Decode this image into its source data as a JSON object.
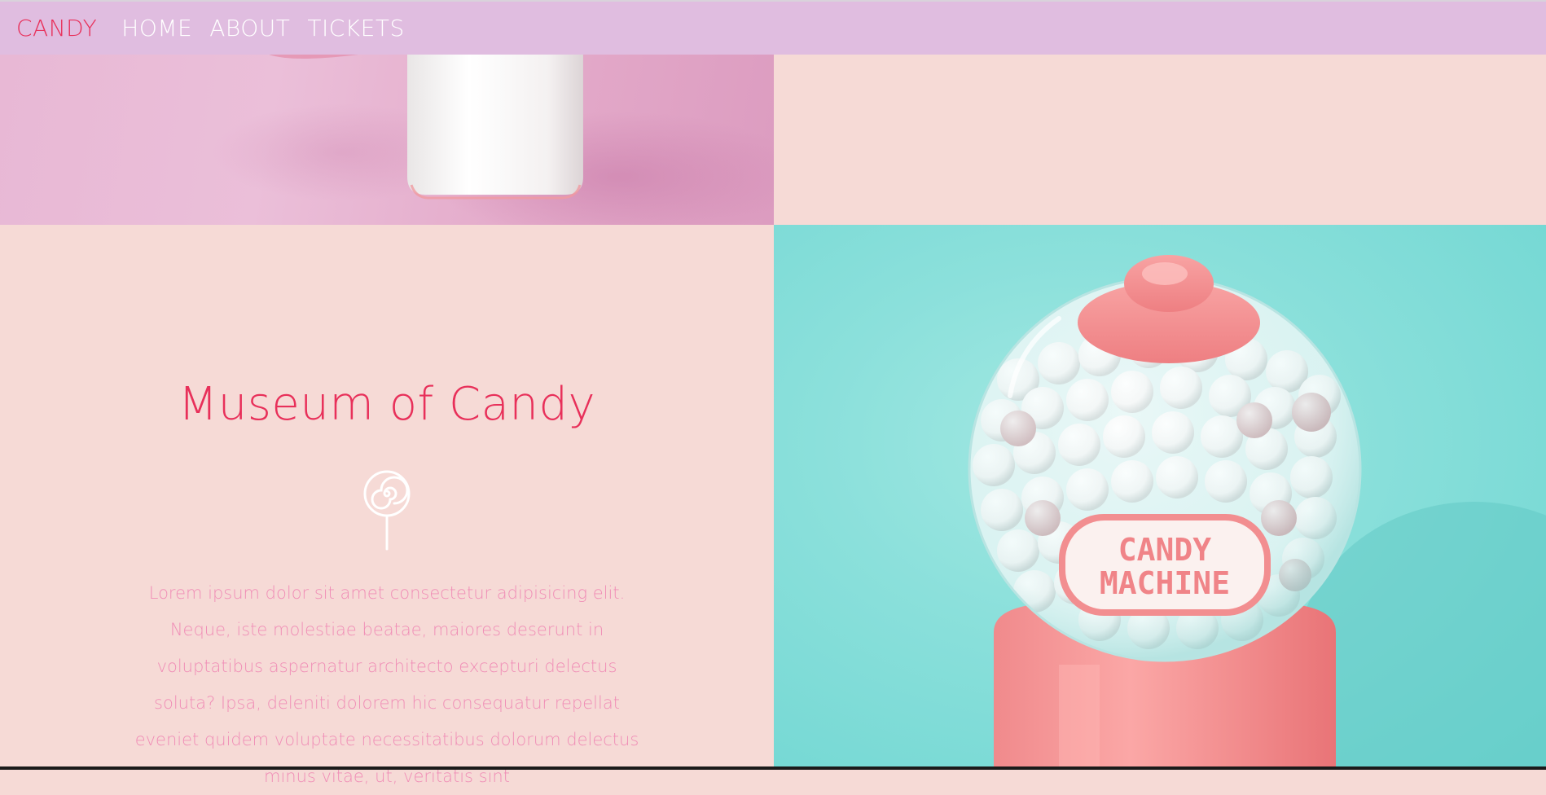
{
  "nav": {
    "brand": "CANDY",
    "links": [
      "HOME",
      "ABOUT",
      "TICKETS"
    ]
  },
  "main": {
    "title": "Museum of Candy",
    "body": "Lorem ipsum dolor sit amet consectetur adipisicing elit. Neque, iste molestiae beatae, maiores deserunt in voluptatibus aspernatur architecto excepturi delectus soluta? Ipsa, deleniti dolorem hic consequatur repellat eveniet quidem voluptate necessitatibus dolorum delectus minus vitae, ut, veritatis sint",
    "icon": "lollipop-icon"
  },
  "images": {
    "top_left": "milk-bottle-photo",
    "right": "gumball-machine-photo",
    "machine_label_line1": "CANDY",
    "machine_label_line2": "MACHINE"
  },
  "colors": {
    "accent": "#e8305a",
    "nav_bg": "#e0bde0",
    "panel_bg": "#f6dad6",
    "body_text": "#f08db6",
    "mint": "#8be0db",
    "coral": "#f48c8c"
  }
}
